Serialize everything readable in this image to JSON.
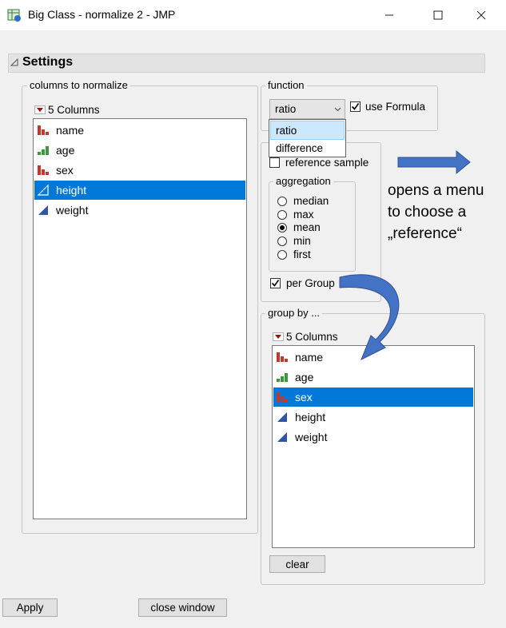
{
  "window": {
    "title": "Big Class - normalize 2 - JMP",
    "app_icon": "jmp-data-icon",
    "controls": [
      "minimize-icon",
      "maximize-icon",
      "close-icon"
    ]
  },
  "settings": {
    "title": "Settings"
  },
  "columns_panel": {
    "legend": "columns to normalize",
    "header": "5 Columns",
    "items": [
      {
        "label": "name",
        "icon": "nominal-icon",
        "selected": false
      },
      {
        "label": "age",
        "icon": "ordinal-icon",
        "selected": false
      },
      {
        "label": "sex",
        "icon": "nominal-icon",
        "selected": false
      },
      {
        "label": "height",
        "icon": "continuous-icon",
        "selected": true
      },
      {
        "label": "weight",
        "icon": "continuous-icon",
        "selected": false
      }
    ]
  },
  "function_panel": {
    "legend": "function",
    "select_value": "ratio",
    "use_formula_label": "use Formula",
    "use_formula_checked": true,
    "dropdown_options": [
      "ratio",
      "difference"
    ]
  },
  "reference_panel": {
    "reference_sample_label": "reference sample",
    "reference_sample_checked": false,
    "aggregation_legend": "aggregation",
    "options": [
      "median",
      "max",
      "mean",
      "min",
      "first"
    ],
    "selected": "mean",
    "per_group_label": "per Group",
    "per_group_checked": true
  },
  "groupby_panel": {
    "legend": "group by ...",
    "header": "5 Columns",
    "items": [
      {
        "label": "name",
        "icon": "nominal-icon",
        "selected": false
      },
      {
        "label": "age",
        "icon": "ordinal-icon",
        "selected": false
      },
      {
        "label": "sex",
        "icon": "nominal-icon",
        "selected": true
      },
      {
        "label": "height",
        "icon": "continuous-icon",
        "selected": false
      },
      {
        "label": "weight",
        "icon": "continuous-icon",
        "selected": false
      }
    ],
    "clear_label": "clear"
  },
  "footer": {
    "apply_label": "Apply",
    "close_label": "close window"
  },
  "annotation": {
    "line1": "opens a menu",
    "line2": "to choose a",
    "line3": "„reference“",
    "arrow_color": "#4472c4"
  },
  "colors": {
    "selection": "#0078d7",
    "nominal": "#c0392b",
    "ordinal": "#3a9a3a",
    "continuous": "#2f55a4"
  }
}
